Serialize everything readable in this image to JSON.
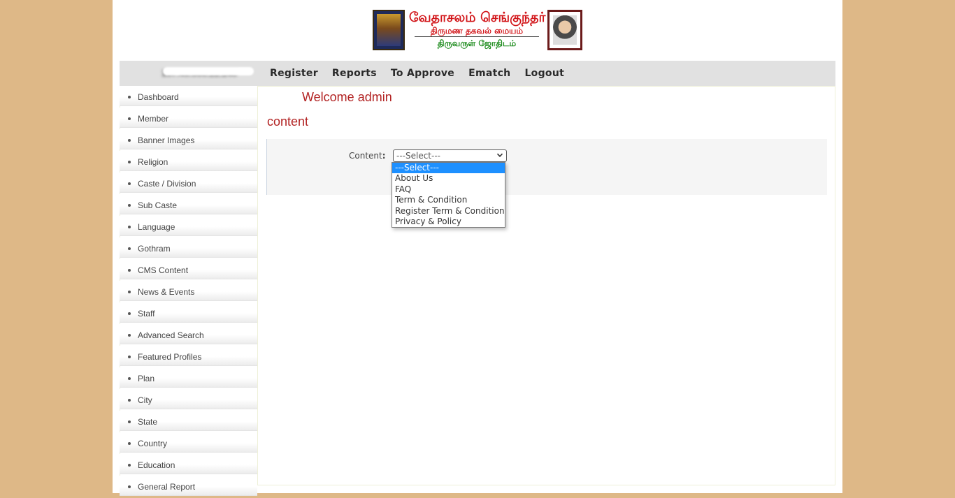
{
  "header": {
    "logo_title": "வேதாசலம் செங்குந்தர்",
    "logo_subtitle": "திருமண தகவல் மையம்",
    "logo_tagline": "திருவருள் ஜோதிடம்",
    "left_image": "deity-picture",
    "right_image": "founder-portrait"
  },
  "navbar": {
    "ip_address": "157.49.000.22.240",
    "links": [
      "Register",
      "Reports",
      "To Approve",
      "Ematch",
      "Logout"
    ]
  },
  "sidebar": {
    "items": [
      "Dashboard",
      "Member",
      "Banner Images",
      "Religion",
      "Caste / Division",
      "Sub Caste",
      "Language",
      "Gothram",
      "CMS Content",
      "News & Events",
      "Staff",
      "Advanced Search",
      "Featured Profiles",
      "Plan",
      "City",
      "State",
      "Country",
      "Education",
      "General Report"
    ]
  },
  "main": {
    "welcome": "Welcome admin",
    "section_title": "content",
    "content_label": "Content",
    "content_label_colon": ":",
    "select_value": "---Select---",
    "select_options": [
      "---Select---",
      "About Us",
      "FAQ",
      "Term & Condition",
      "Register Term & Condition",
      "Privacy & Policy"
    ],
    "selected_option_index": 0
  },
  "colors": {
    "background": "#deb887",
    "accent_text": "#b22222",
    "navbar": "#e1e1e1",
    "logo_red": "#d2161a",
    "logo_green": "#1a8a1a",
    "dropdown_highlight": "#1e90ff"
  }
}
